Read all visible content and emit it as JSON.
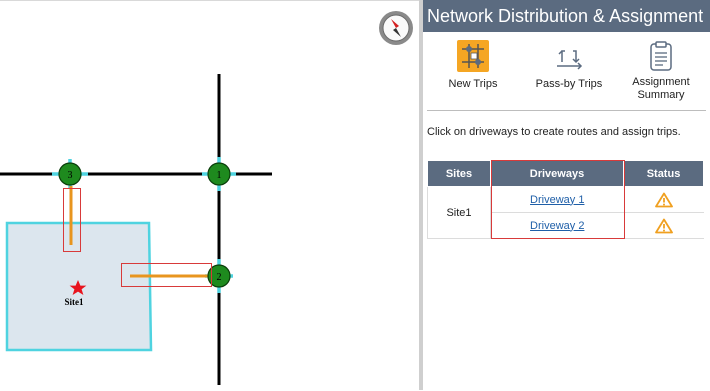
{
  "panel": {
    "title": "Network Distribution & Assignment",
    "tools": [
      {
        "label": "New Trips",
        "icon": "network-trips-icon"
      },
      {
        "label": "Pass-by Trips",
        "icon": "pass-by-arrows-icon"
      },
      {
        "label": "Assignment Summary",
        "icon": "clipboard-icon"
      }
    ],
    "instructions": "Click on driveways to create routes and assign trips.",
    "table": {
      "headers": [
        "Sites",
        "Driveways",
        "Status"
      ],
      "site": "Site1",
      "rows": [
        {
          "driveway": "Driveway 1",
          "status": "warning"
        },
        {
          "driveway": "Driveway 2",
          "status": "warning"
        }
      ]
    }
  },
  "map": {
    "nodes": [
      "3",
      "1",
      "2"
    ],
    "site_label": "Site1",
    "compass": "compass-icon",
    "colors": {
      "road": "#000000",
      "node": "#1e8a1e",
      "connector": "#4fd3e0",
      "driveway": "#e8951f",
      "site_fill": "#dce6ee",
      "site_border": "#4fd3e0",
      "highlight": "#d83a3a",
      "warning": "#f0a020"
    }
  }
}
